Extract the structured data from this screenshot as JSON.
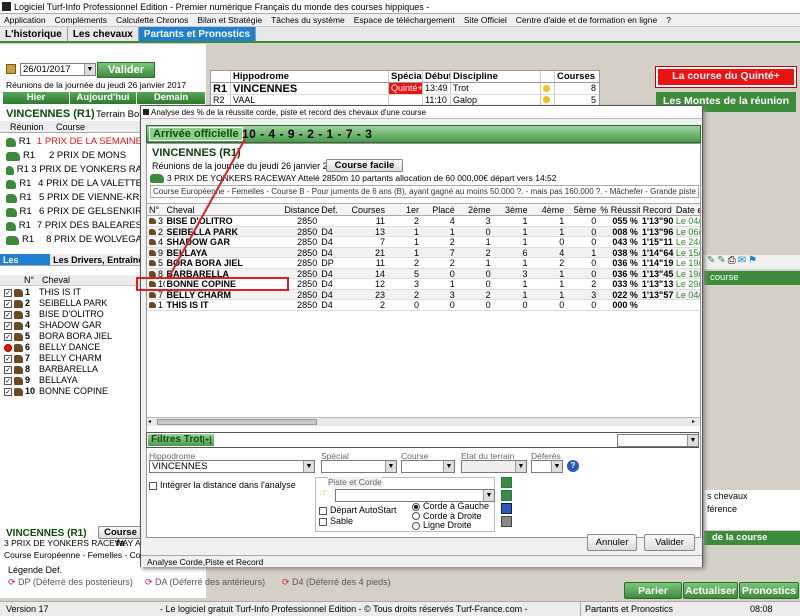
{
  "window_title": "Logiciel Turf-Info Professionnel Edition - Premier numérique Français du monde des courses hippiques -",
  "menu": [
    "Application",
    "Compléments",
    "Calculette Chronos",
    "Bilan et Stratégie",
    "Tâches du système",
    "Espace de téléchargement",
    "Site Officiel",
    "Centre d'aide et de formation en ligne",
    "?"
  ],
  "main_tabs": [
    "L'historique",
    "Les chevaux",
    "Partants et Pronostics"
  ],
  "date": "26/01/2017",
  "valider": "Valider",
  "reunions_label": "Réunions de la journée du jeudi 26 janvier 2017",
  "nav": {
    "hier": "Hier",
    "aujourdhui": "Aujourd'hui",
    "demain": "Demain"
  },
  "reunion_header": {
    "name": "VINCENNES (R1)",
    "terrain": "Terrain Bon"
  },
  "list_headers": {
    "reunion": "Réunion",
    "course": "Course"
  },
  "courses": [
    {
      "r": "R1",
      "c": "1 PRIX DE LA SEMAINE",
      "red": true
    },
    {
      "r": "R1",
      "c": "2 PRIX DE MONS",
      "red": false
    },
    {
      "r": "R1",
      "c": "3 PRIX DE YONKERS RA",
      "red": false
    },
    {
      "r": "R1",
      "c": "4 PRIX DE LA VALETTE",
      "red": false
    },
    {
      "r": "R1",
      "c": "5 PRIX DE VIENNE-KRI",
      "red": false
    },
    {
      "r": "R1",
      "c": "6 PRIX DE GELSENKIR",
      "red": false
    },
    {
      "r": "R1",
      "c": "7 PRIX DES BALEARES",
      "red": false
    },
    {
      "r": "R1",
      "c": "8 PRIX DE WOLVEGA",
      "red": false
    }
  ],
  "left_tabs": [
    "Les partants",
    "Les Drivers, Entraîneurs"
  ],
  "partants_headers": {
    "n": "N°",
    "cheval": "Cheval"
  },
  "partants": [
    {
      "n": "1",
      "name": "THIS IS IT"
    },
    {
      "n": "2",
      "name": "SEIBELLA PARK"
    },
    {
      "n": "3",
      "name": "BISE D'OLITRO"
    },
    {
      "n": "4",
      "name": "SHADOW GAR"
    },
    {
      "n": "5",
      "name": "BORA BORA JIEL"
    },
    {
      "n": "6",
      "name": "BELLY DANCE"
    },
    {
      "n": "7",
      "name": "BELLY CHARM"
    },
    {
      "n": "8",
      "name": "BARBARELLA"
    },
    {
      "n": "9",
      "name": "BELLAYA"
    },
    {
      "n": "10",
      "name": "BONNE COPINE"
    }
  ],
  "bottom_left": {
    "reunion": "VINCENNES (R1)",
    "course_btn": "Course fa",
    "course_name": "3 PRIX DE YONKERS RACEWAY Attelé",
    "conditions": "Course Européenne - Femelles - Course B"
  },
  "legend": {
    "title": "Légende Def.",
    "dp": "DP (Déferré des postérieurs)",
    "da": "DA (Déferré des antérieurs)",
    "d4": "D4 (Déferré des 4 pieds)"
  },
  "top_table": {
    "headers": [
      "",
      "Hippodrome",
      "Spécial",
      "Début",
      "Discipline",
      "",
      "Courses"
    ],
    "rows": [
      {
        "r": "R1",
        "hippo": "VINCENNES",
        "special": "Quinté+",
        "debut": "13:49",
        "disc": "Trot",
        "courses": "8"
      },
      {
        "r": "R2",
        "hippo": "VAAL",
        "special": "",
        "debut": "11:10",
        "disc": "Galop",
        "courses": "5"
      }
    ]
  },
  "right_boxes": {
    "quinte": "La course du Quinté+",
    "montes": "Les Montes de la réunion"
  },
  "right_misc": {
    "course": "course",
    "chevaux": "s chevaux",
    "ference": "férence",
    "details": "de la course"
  },
  "dialog": {
    "title": "Analyse des % de la réussite corde, piste et record des chevaux d'une course",
    "arrivee_label": "Arrivée officielle",
    "arrivee_result": "10 - 4 - 9 - 2 - 1 - 7 - 3",
    "reunion": "VINCENNES (R1)",
    "date_label": "Réunions de la journée du jeudi 26 janvier 2017",
    "course_facile": "Course facile",
    "course_title": "3 PRIX DE YONKERS RACEWAY Attelé 2850m 10 partants allocation de 60 000,00€ départ vers 14:52",
    "conditions": "Course Européenne - Femelles - Course B - Pour juments de 6 ans (B), ayant gagné au moins 50.000 ?. - mais pas 160.000 ?. - Mâchefer - Grande piste -",
    "headers": [
      "N°",
      "Cheval",
      "Distance",
      "Def.",
      "Courses",
      "1er",
      "Placé",
      "2ème",
      "3ème",
      "4ème",
      "5ème",
      "% Réussite",
      "Record",
      "Date e"
    ],
    "rows": [
      [
        "3",
        "BISE D'OLITRO",
        "2850",
        "",
        "11",
        "2",
        "4",
        "3",
        "1",
        "1",
        "0",
        "055 %",
        "1'13\"90",
        "Le 04/"
      ],
      [
        "2",
        "SEIBELLA PARK",
        "2850",
        "D4",
        "13",
        "1",
        "1",
        "0",
        "1",
        "1",
        "0",
        "008 %",
        "1'13\"96",
        "Le 06/"
      ],
      [
        "4",
        "SHADOW GAR",
        "2850",
        "D4",
        "7",
        "1",
        "2",
        "1",
        "1",
        "0",
        "0",
        "043 %",
        "1'15\"11",
        "Le 24/"
      ],
      [
        "9",
        "BELLAYA",
        "2850",
        "D4",
        "21",
        "1",
        "7",
        "2",
        "6",
        "4",
        "1",
        "038 %",
        "1'14\"64",
        "Le 15/"
      ],
      [
        "5",
        "BORA BORA JIEL",
        "2850",
        "DP",
        "11",
        "2",
        "2",
        "1",
        "1",
        "2",
        "0",
        "036 %",
        "1'14\"19",
        "Le 19/"
      ],
      [
        "8",
        "BARBARELLA",
        "2850",
        "D4",
        "14",
        "5",
        "0",
        "0",
        "3",
        "1",
        "0",
        "036 %",
        "1'13\"45",
        "Le 19/"
      ],
      [
        "10",
        "BONNE COPINE",
        "2850",
        "D4",
        "12",
        "3",
        "1",
        "0",
        "1",
        "1",
        "2",
        "033 %",
        "1'13\"13",
        "Le 29/"
      ],
      [
        "7",
        "BELLY CHARM",
        "2850",
        "D4",
        "23",
        "2",
        "3",
        "2",
        "1",
        "1",
        "3",
        "022 %",
        "1'13\"57",
        "Le 04/"
      ],
      [
        "1",
        "THIS IS IT",
        "2850",
        "D4",
        "2",
        "0",
        "0",
        "0",
        "0",
        "0",
        "0",
        "000 %",
        "",
        ""
      ]
    ],
    "filtres_label": "Filtres Trot",
    "filtres_plus": "[+]",
    "f_hippodrome": "Hippodrome",
    "f_hippodrome_val": "VINCENNES",
    "f_special": "Spécial",
    "f_course": "Course",
    "f_terrain": "Etat du terrain",
    "f_deferes": "Déferés",
    "integrer": "Intégrer la distance dans l'analyse",
    "piste_corde": "Piste et Corde",
    "depart_auto": "Départ AutoStart",
    "sable": "Sable",
    "corde_gauche": "Corde à Gauche",
    "corde_droite": "Corde à Droite",
    "ligne_droite": "Ligne Droite",
    "annuler": "Annuler",
    "valider": "Valider",
    "status": "Analyse Corde,Piste et Record"
  },
  "right_buttons": {
    "parier": "Parier",
    "actualiser": "Actualiser",
    "pronostics": "Pronostics"
  },
  "status": {
    "version": "Version 17",
    "copyright": "- Le logiciel gratuit Turf-Info Professionnel Edition - © Tous droits réservés Turf-France.com -",
    "section": "Partants et Pronostics",
    "time": "08:08"
  },
  "colors": {
    "green": "#3c8c3c",
    "red": "#e11",
    "blue": "#1f7fd1"
  }
}
